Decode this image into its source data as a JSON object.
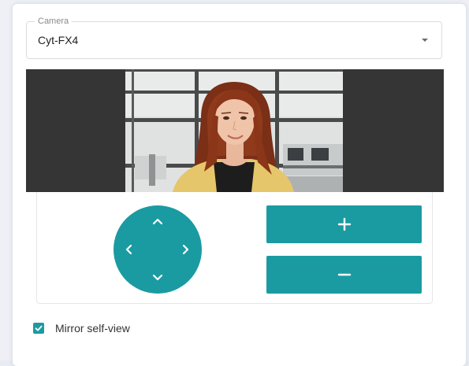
{
  "camera": {
    "label": "Camera",
    "value": "Cyt-FX4",
    "caret_icon": "caret-down-icon"
  },
  "preview": {
    "description_icon": "video-preview"
  },
  "ptz": {
    "up_icon": "chevron-up-icon",
    "down_icon": "chevron-down-icon",
    "left_icon": "chevron-left-icon",
    "right_icon": "chevron-right-icon",
    "zoom_in_icon": "plus-icon",
    "zoom_out_icon": "minus-icon"
  },
  "mirror": {
    "label": "Mirror self-view",
    "checked": true
  },
  "colors": {
    "accent": "#1a9ba1",
    "video_background": "#353535"
  }
}
